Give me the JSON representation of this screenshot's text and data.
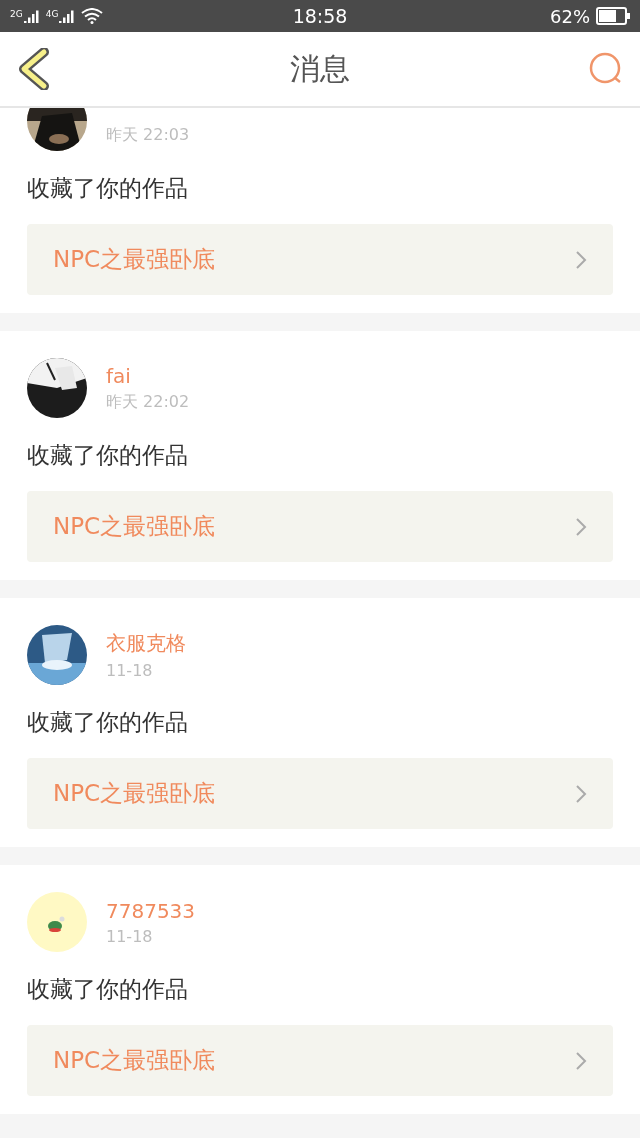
{
  "status_bar": {
    "signal_1": "2G",
    "signal_2": "4G",
    "time": "18:58",
    "battery": "62%"
  },
  "header": {
    "title": "消息"
  },
  "messages": [
    {
      "time": "昨天 22:03",
      "text": "收藏了你的作品",
      "work": "NPC之最强卧底"
    },
    {
      "user": "fai",
      "time": "昨天 22:02",
      "text": "收藏了你的作品",
      "work": "NPC之最强卧底"
    },
    {
      "user": "衣服克格",
      "time": "11-18",
      "text": "收藏了你的作品",
      "work": "NPC之最强卧底"
    },
    {
      "user": "7787533",
      "time": "11-18",
      "text": "收藏了你的作品",
      "work": "NPC之最强卧底"
    }
  ]
}
